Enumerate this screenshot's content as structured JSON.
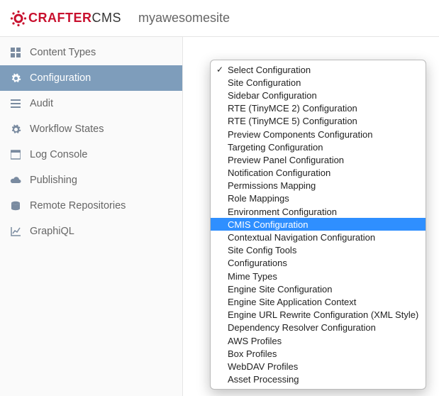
{
  "header": {
    "brand_left": "CRAFTER",
    "brand_right": "CMS",
    "site_name": "myawesomesite"
  },
  "sidebar": {
    "items": [
      {
        "icon": "grid-icon",
        "label": "Content Types",
        "selected": false
      },
      {
        "icon": "gear-icon",
        "label": "Configuration",
        "selected": true
      },
      {
        "icon": "list-icon",
        "label": "Audit",
        "selected": false
      },
      {
        "icon": "gear-icon",
        "label": "Workflow States",
        "selected": false
      },
      {
        "icon": "terminal-icon",
        "label": "Log Console",
        "selected": false
      },
      {
        "icon": "cloud-icon",
        "label": "Publishing",
        "selected": false
      },
      {
        "icon": "database-icon",
        "label": "Remote Repositories",
        "selected": false
      },
      {
        "icon": "chart-icon",
        "label": "GraphiQL",
        "selected": false
      }
    ]
  },
  "dropdown": {
    "items": [
      {
        "label": "Select Configuration",
        "checked": true,
        "highlighted": false
      },
      {
        "label": "Site Configuration",
        "checked": false,
        "highlighted": false
      },
      {
        "label": "Sidebar Configuration",
        "checked": false,
        "highlighted": false
      },
      {
        "label": "RTE (TinyMCE 2) Configuration",
        "checked": false,
        "highlighted": false
      },
      {
        "label": "RTE (TinyMCE 5) Configuration",
        "checked": false,
        "highlighted": false
      },
      {
        "label": "Preview Components Configuration",
        "checked": false,
        "highlighted": false
      },
      {
        "label": "Targeting Configuration",
        "checked": false,
        "highlighted": false
      },
      {
        "label": "Preview Panel Configuration",
        "checked": false,
        "highlighted": false
      },
      {
        "label": "Notification Configuration",
        "checked": false,
        "highlighted": false
      },
      {
        "label": "Permissions Mapping",
        "checked": false,
        "highlighted": false
      },
      {
        "label": "Role Mappings",
        "checked": false,
        "highlighted": false
      },
      {
        "label": "Environment Configuration",
        "checked": false,
        "highlighted": false
      },
      {
        "label": "CMIS Configuration",
        "checked": false,
        "highlighted": true
      },
      {
        "label": "Contextual Navigation Configuration",
        "checked": false,
        "highlighted": false
      },
      {
        "label": "Site Config Tools",
        "checked": false,
        "highlighted": false
      },
      {
        "label": "Configurations",
        "checked": false,
        "highlighted": false
      },
      {
        "label": "Mime Types",
        "checked": false,
        "highlighted": false
      },
      {
        "label": "Engine Site Configuration",
        "checked": false,
        "highlighted": false
      },
      {
        "label": "Engine Site Application Context",
        "checked": false,
        "highlighted": false
      },
      {
        "label": "Engine URL Rewrite Configuration (XML Style)",
        "checked": false,
        "highlighted": false
      },
      {
        "label": "Dependency Resolver Configuration",
        "checked": false,
        "highlighted": false
      },
      {
        "label": "AWS Profiles",
        "checked": false,
        "highlighted": false
      },
      {
        "label": "Box Profiles",
        "checked": false,
        "highlighted": false
      },
      {
        "label": "WebDAV Profiles",
        "checked": false,
        "highlighted": false
      },
      {
        "label": "Asset Processing",
        "checked": false,
        "highlighted": false
      }
    ]
  }
}
